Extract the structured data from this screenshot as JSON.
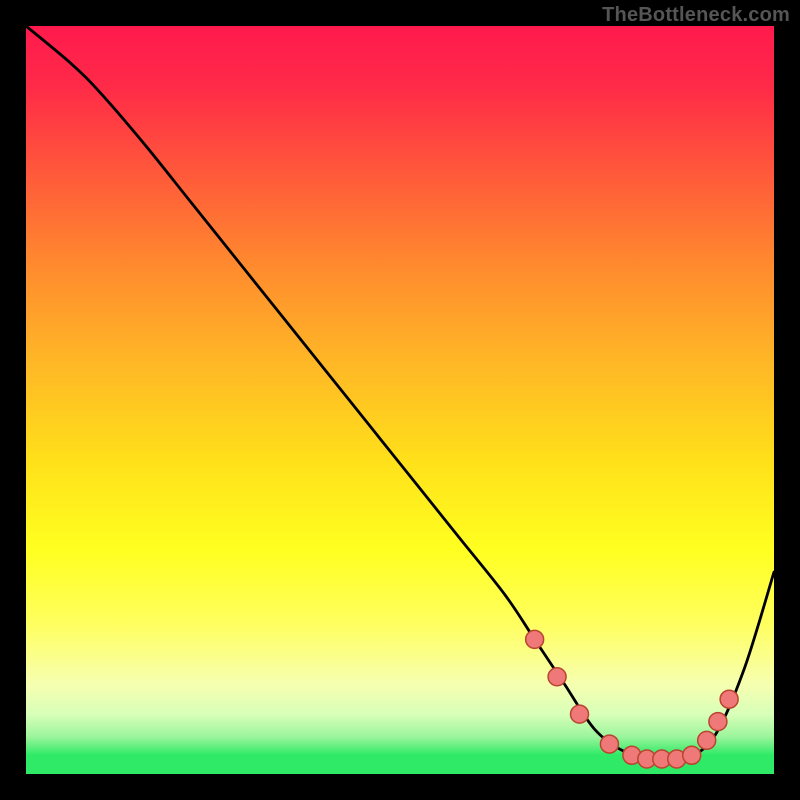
{
  "watermark": "TheBottleneck.com",
  "colors": {
    "frame": "#000000",
    "gradient_top": "#ff1a4d",
    "gradient_mid": "#ffff20",
    "gradient_bottom": "#2eea66",
    "curve_stroke": "#000000",
    "marker_fill": "#ef7878",
    "marker_stroke": "#b9452f"
  },
  "chart_data": {
    "type": "line",
    "title": "",
    "xlabel": "",
    "ylabel": "",
    "xlim": [
      0,
      100
    ],
    "ylim": [
      0,
      100
    ],
    "grid": false,
    "legend": false,
    "series": [
      {
        "name": "curve",
        "x": [
          0,
          6,
          10,
          16,
          22,
          28,
          34,
          40,
          46,
          52,
          58,
          64,
          68,
          72,
          76,
          80,
          84,
          88,
          92,
          96,
          100
        ],
        "y": [
          100,
          95,
          91,
          84,
          76.5,
          69,
          61.5,
          54,
          46.5,
          39,
          31.5,
          24,
          18,
          12,
          6,
          3,
          2,
          2,
          5,
          14,
          27
        ],
        "markers": [
          {
            "x": 68,
            "y": 18
          },
          {
            "x": 71,
            "y": 13
          },
          {
            "x": 74,
            "y": 8
          },
          {
            "x": 78,
            "y": 4
          },
          {
            "x": 81,
            "y": 2.5
          },
          {
            "x": 83,
            "y": 2
          },
          {
            "x": 85,
            "y": 2
          },
          {
            "x": 87,
            "y": 2
          },
          {
            "x": 89,
            "y": 2.5
          },
          {
            "x": 91,
            "y": 4.5
          },
          {
            "x": 92.5,
            "y": 7
          },
          {
            "x": 94,
            "y": 10
          }
        ]
      }
    ]
  }
}
